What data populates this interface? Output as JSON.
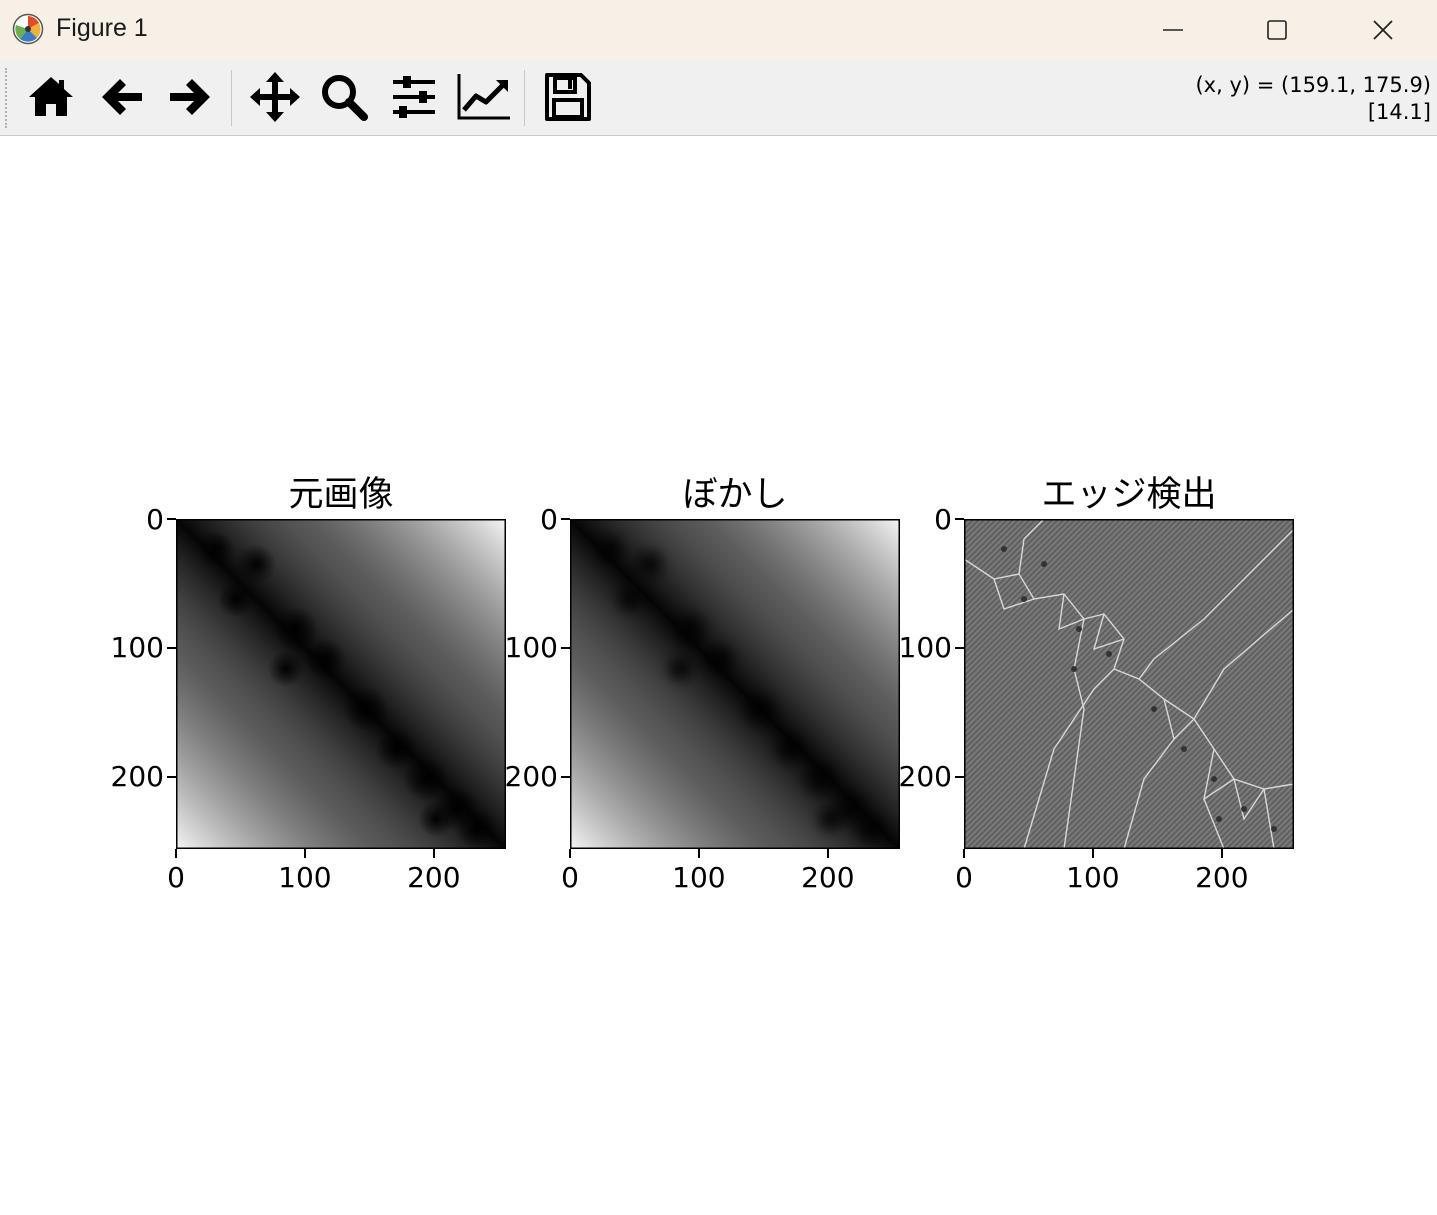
{
  "window": {
    "title": "Figure 1",
    "controls": [
      "minimize",
      "maximize",
      "close"
    ]
  },
  "toolbar": {
    "tools": [
      {
        "name": "home",
        "icon": "home-icon"
      },
      {
        "name": "back",
        "icon": "arrow-left-icon"
      },
      {
        "name": "forward",
        "icon": "arrow-right-icon"
      },
      {
        "name": "pan",
        "icon": "move-icon"
      },
      {
        "name": "zoom",
        "icon": "magnifier-icon"
      },
      {
        "name": "configure-subplots",
        "icon": "sliders-icon"
      },
      {
        "name": "edit-axis",
        "icon": "line-chart-icon"
      },
      {
        "name": "save",
        "icon": "floppy-disk-icon"
      }
    ],
    "coords_line1": "(x, y) = (159.1, 175.9)",
    "coords_line2": "[14.1]"
  },
  "figure": {
    "panels": [
      {
        "title": "元画像",
        "image": "smooth dark diagonal band with dark blob cells"
      },
      {
        "title": "ぼかし",
        "image": "blurred version of the original image"
      },
      {
        "title": "エッジ検出",
        "image": "gray edge map with cell boundary lines"
      }
    ],
    "x_ticks": [
      "0",
      "100",
      "200"
    ],
    "y_ticks": [
      "0",
      "100",
      "200"
    ],
    "colors": {
      "axis": "#000000",
      "edge_bg": "#6e6e6e",
      "edge_line": "#d8d8d8"
    }
  }
}
